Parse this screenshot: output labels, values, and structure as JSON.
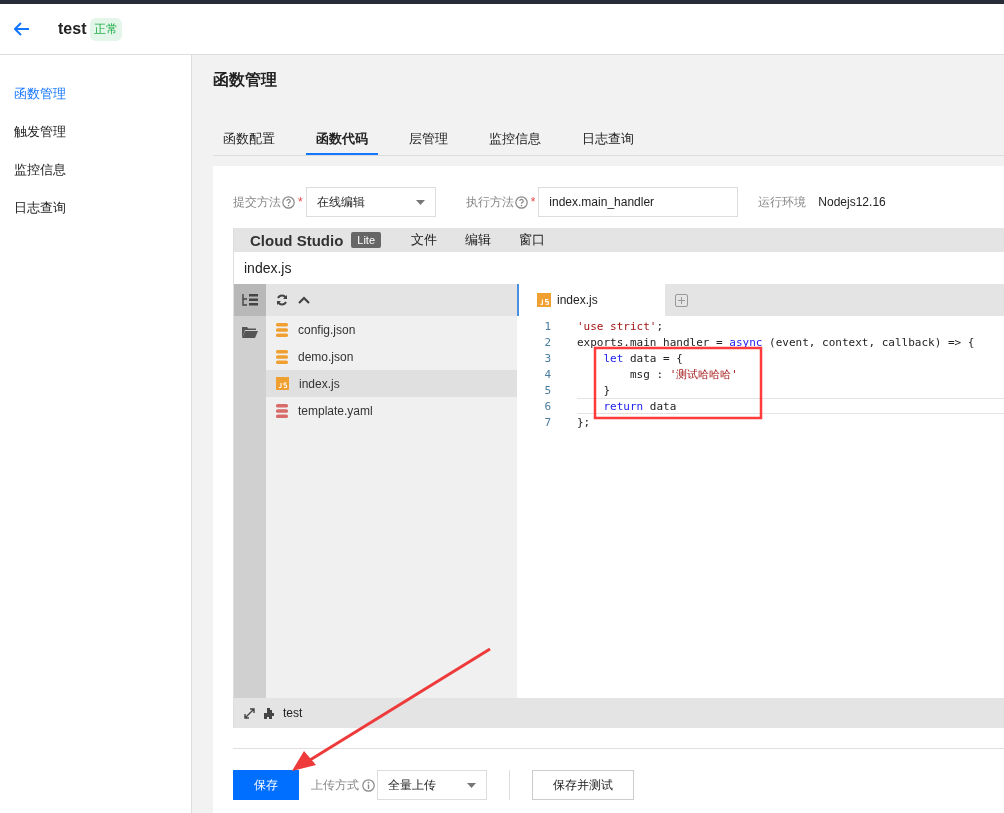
{
  "header": {
    "title": "test",
    "status": "正常"
  },
  "sidebar": {
    "items": [
      {
        "label": "函数管理",
        "selected": true
      },
      {
        "label": "触发管理",
        "selected": false
      },
      {
        "label": "监控信息",
        "selected": false
      },
      {
        "label": "日志查询",
        "selected": false
      }
    ]
  },
  "page_title": "函数管理",
  "tabs": [
    {
      "label": "函数配置",
      "selected": false
    },
    {
      "label": "函数代码",
      "selected": true
    },
    {
      "label": "层管理",
      "selected": false
    },
    {
      "label": "监控信息",
      "selected": false
    },
    {
      "label": "日志查询",
      "selected": false
    }
  ],
  "form": {
    "submit_method": {
      "label": "提交方法",
      "required_mark": "*",
      "value": "在线编辑"
    },
    "handler": {
      "label": "执行方法",
      "required_mark": "*",
      "value": "index.main_handler"
    },
    "runtime": {
      "label": "运行环境",
      "value": "Nodejs12.16"
    }
  },
  "editor": {
    "brand": "Cloud Studio",
    "brand_badge": "Lite",
    "menu": [
      "文件",
      "编辑",
      "窗口"
    ],
    "file_path": "index.js",
    "files": [
      {
        "name": "config.json",
        "kind": "json",
        "selected": false
      },
      {
        "name": "demo.json",
        "kind": "json",
        "selected": false
      },
      {
        "name": "index.js",
        "kind": "js",
        "selected": true
      },
      {
        "name": "template.yaml",
        "kind": "yaml",
        "selected": false
      }
    ],
    "open_tab": "index.js",
    "code_lines": [
      {
        "number": "1",
        "current": false,
        "tokens": [
          {
            "text": "'use strict'",
            "kind": "string"
          },
          {
            "text": ";",
            "kind": "plain"
          }
        ]
      },
      {
        "number": "2",
        "current": false,
        "tokens": [
          {
            "text": "exports.main_handler = ",
            "kind": "plain"
          },
          {
            "text": "async",
            "kind": "keyword"
          },
          {
            "text": " (event, context, callback) => {",
            "kind": "plain"
          }
        ]
      },
      {
        "number": "3",
        "current": false,
        "tokens": [
          {
            "text": "    let",
            "kind": "keyword"
          },
          {
            "text": " data = {",
            "kind": "plain"
          }
        ]
      },
      {
        "number": "4",
        "current": false,
        "tokens": [
          {
            "text": "        msg : ",
            "kind": "plain"
          },
          {
            "text": "'测试哈哈哈'",
            "kind": "string"
          }
        ]
      },
      {
        "number": "5",
        "current": false,
        "tokens": [
          {
            "text": "    }",
            "kind": "plain"
          }
        ]
      },
      {
        "number": "6",
        "current": true,
        "tokens": [
          {
            "text": "    return",
            "kind": "keyword"
          },
          {
            "text": " data",
            "kind": "plain"
          }
        ]
      },
      {
        "number": "7",
        "current": false,
        "tokens": [
          {
            "text": "};",
            "kind": "plain"
          }
        ]
      }
    ],
    "project": "test"
  },
  "footer": {
    "save": "保存",
    "upload_label": "上传方式",
    "upload_value": "全量上传",
    "save_test": "保存并测试"
  }
}
